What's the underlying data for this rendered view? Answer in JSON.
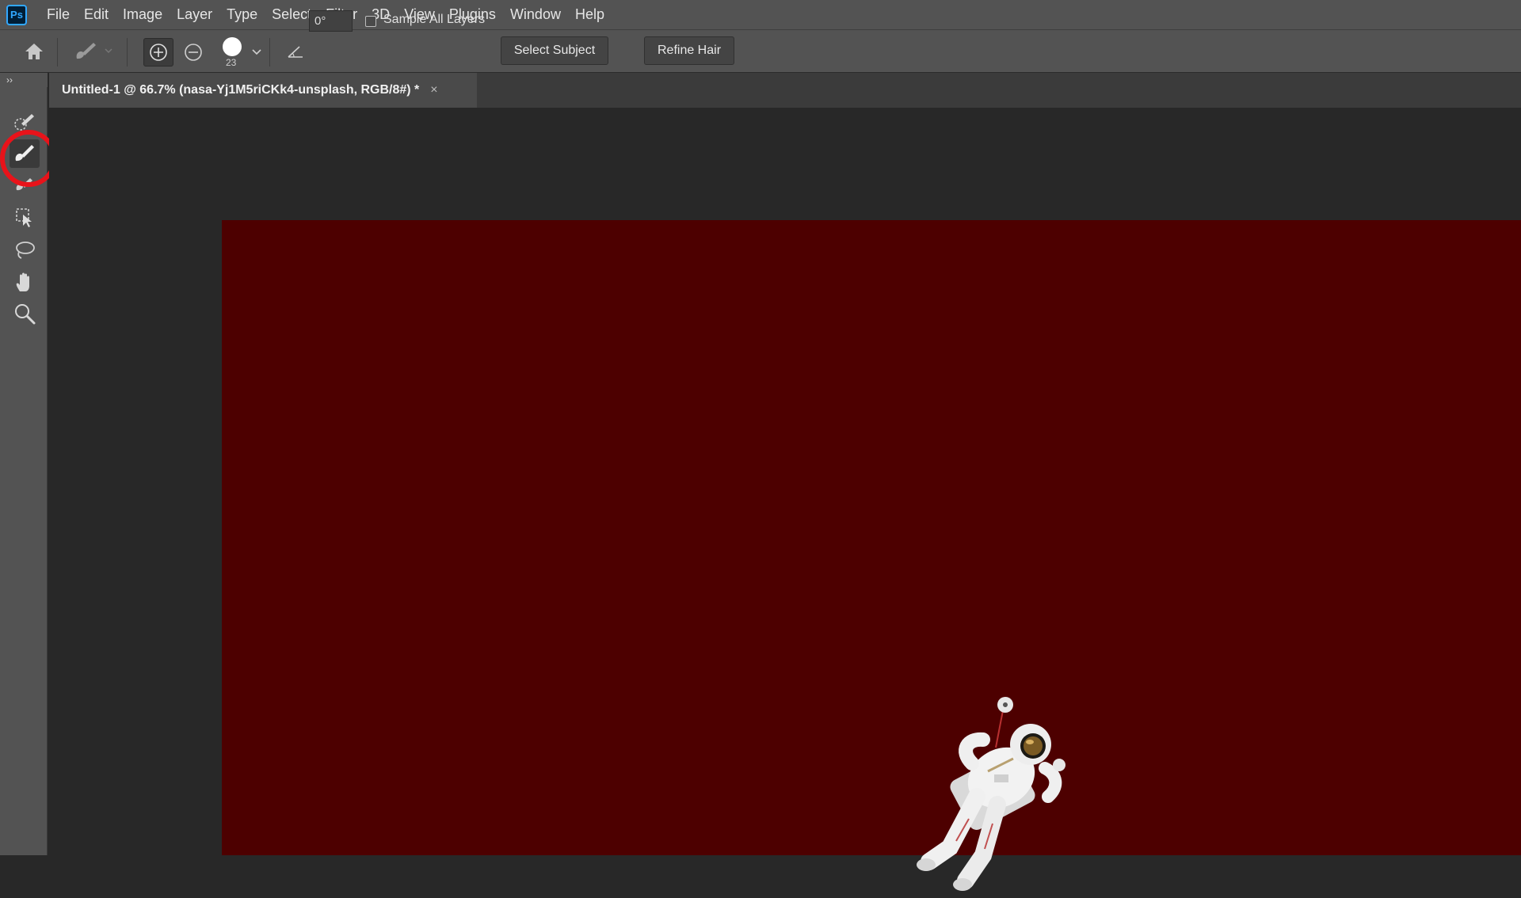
{
  "app": {
    "logo": "Ps"
  },
  "menu": [
    "File",
    "Edit",
    "Image",
    "Layer",
    "Type",
    "Select",
    "Filter",
    "3D",
    "View",
    "Plugins",
    "Window",
    "Help"
  ],
  "options": {
    "brush_size": "23",
    "angle": "0°",
    "sample_all_layers_label": "Sample All Layers",
    "sample_all_layers_checked": false,
    "select_subject_label": "Select Subject",
    "refine_hair_label": "Refine Hair"
  },
  "document": {
    "tab_title": "Untitled-1 @ 66.7% (nasa-Yj1M5riCKk4-unsplash, RGB/8#) *",
    "close_glyph": "×",
    "canvas_color": "#4d0000"
  },
  "toolbar": {
    "collapse_glyph": "››",
    "tools": [
      "quick-selection-icon",
      "select-and-mask-brush-icon",
      "refine-edge-brush-icon",
      "object-selection-icon",
      "lasso-icon",
      "hand-icon",
      "zoom-icon"
    ],
    "active_tool": "select-and-mask-brush-icon"
  },
  "colors": {
    "accent": "#31a8ff",
    "highlight_ring": "#e8131a",
    "panel": "#535353",
    "workspace": "#282828"
  }
}
